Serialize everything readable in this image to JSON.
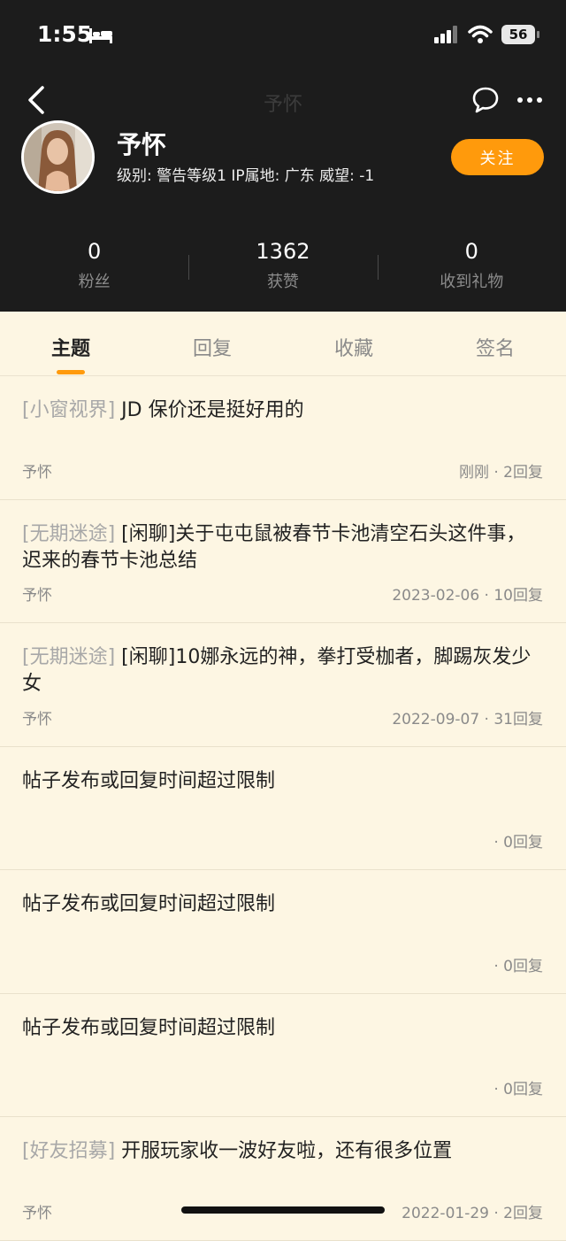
{
  "status_bar": {
    "time": "1:55",
    "battery": "56"
  },
  "nav": {
    "title": "予怀"
  },
  "profile": {
    "name": "予怀",
    "meta": "级别: 警告等级1  IP属地: 广东  威望: -1",
    "follow_label": "关注"
  },
  "stats": [
    {
      "value": "0",
      "label": "粉丝"
    },
    {
      "value": "1362",
      "label": "获赞"
    },
    {
      "value": "0",
      "label": "收到礼物"
    }
  ],
  "tabs": [
    {
      "label": "主题",
      "active": true
    },
    {
      "label": "回复",
      "active": false
    },
    {
      "label": "收藏",
      "active": false
    },
    {
      "label": "签名",
      "active": false
    }
  ],
  "posts": [
    {
      "tag": "[小窗视界]",
      "title": " JD 保价还是挺好用的",
      "author": "予怀",
      "info": "刚刚 · 2回复"
    },
    {
      "tag": "[无期迷途]",
      "title": " [闲聊]关于屯屯鼠被春节卡池清空石头这件事，迟来的春节卡池总结",
      "author": "予怀",
      "info": "2023-02-06 · 10回复"
    },
    {
      "tag": "[无期迷途]",
      "title": " [闲聊]10娜永远的神，拳打受枷者，脚踢灰发少女",
      "author": "予怀",
      "info": "2022-09-07 · 31回复"
    },
    {
      "tag": "",
      "title": "帖子发布或回复时间超过限制",
      "author": "",
      "info": "· 0回复"
    },
    {
      "tag": "",
      "title": "帖子发布或回复时间超过限制",
      "author": "",
      "info": "· 0回复"
    },
    {
      "tag": "",
      "title": "帖子发布或回复时间超过限制",
      "author": "",
      "info": "· 0回复"
    },
    {
      "tag": "[好友招募]",
      "title": " 开服玩家收一波好友啦，还有很多位置",
      "author": "予怀",
      "info": "2022-01-29 · 2回复"
    }
  ],
  "colors": {
    "accent": "#ff9a0c",
    "header_bg": "#1c1c1c",
    "page_bg": "#fdf6e3"
  }
}
